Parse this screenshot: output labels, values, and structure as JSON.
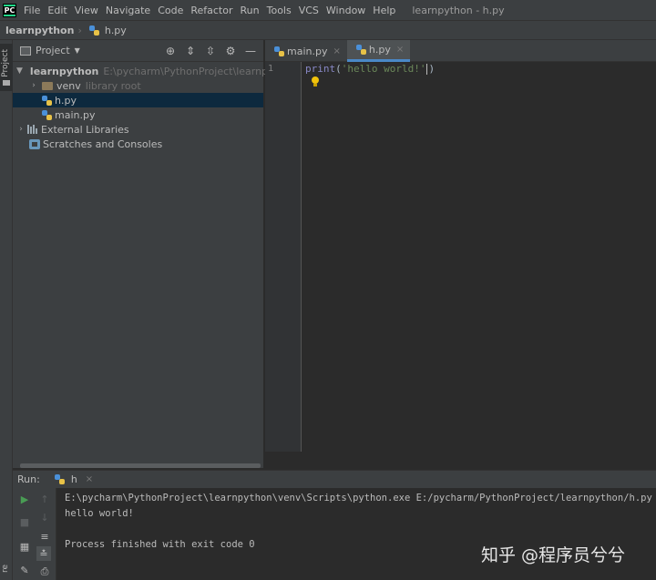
{
  "menubar": {
    "logo": "PC",
    "items": [
      "File",
      "Edit",
      "View",
      "Navigate",
      "Code",
      "Refactor",
      "Run",
      "Tools",
      "VCS",
      "Window",
      "Help"
    ],
    "window_title": "learnpython - h.py"
  },
  "navbar": {
    "project": "learnpython",
    "file": "h.py"
  },
  "left_stripe": {
    "project_tab": "Project",
    "bottom_tab": "re"
  },
  "project_panel": {
    "title": "Project",
    "tree": [
      {
        "label": "learnpython",
        "hint": "E:\\pycharm\\PythonProject\\learnpython"
      },
      {
        "label": "venv",
        "hint": "library root"
      },
      {
        "label": "h.py"
      },
      {
        "label": "main.py"
      },
      {
        "label": "External Libraries"
      },
      {
        "label": "Scratches and Consoles"
      }
    ]
  },
  "editor": {
    "tabs": [
      {
        "label": "main.py",
        "close": "×"
      },
      {
        "label": "h.py",
        "close": "×"
      }
    ],
    "line_number": "1",
    "code": {
      "fn": "print",
      "open": "(",
      "str": "'hello world!'",
      "close": ")"
    }
  },
  "run": {
    "label": "Run:",
    "tab": "h",
    "tab_close": "×",
    "console": {
      "command": "E:\\pycharm\\PythonProject\\learnpython\\venv\\Scripts\\python.exe E:/pycharm/PythonProject/learnpython/h.py",
      "output": "hello world!",
      "exit": "Process finished with exit code 0"
    }
  },
  "watermark": "知乎 @程序员兮兮",
  "colors": {
    "background": "#2b2b2b",
    "panel": "#3c3f41",
    "selection": "#0d293e",
    "tab_active_underline": "#4a88c7",
    "string": "#6a8759",
    "builtin": "#8888c6",
    "run_green": "#499c54"
  }
}
